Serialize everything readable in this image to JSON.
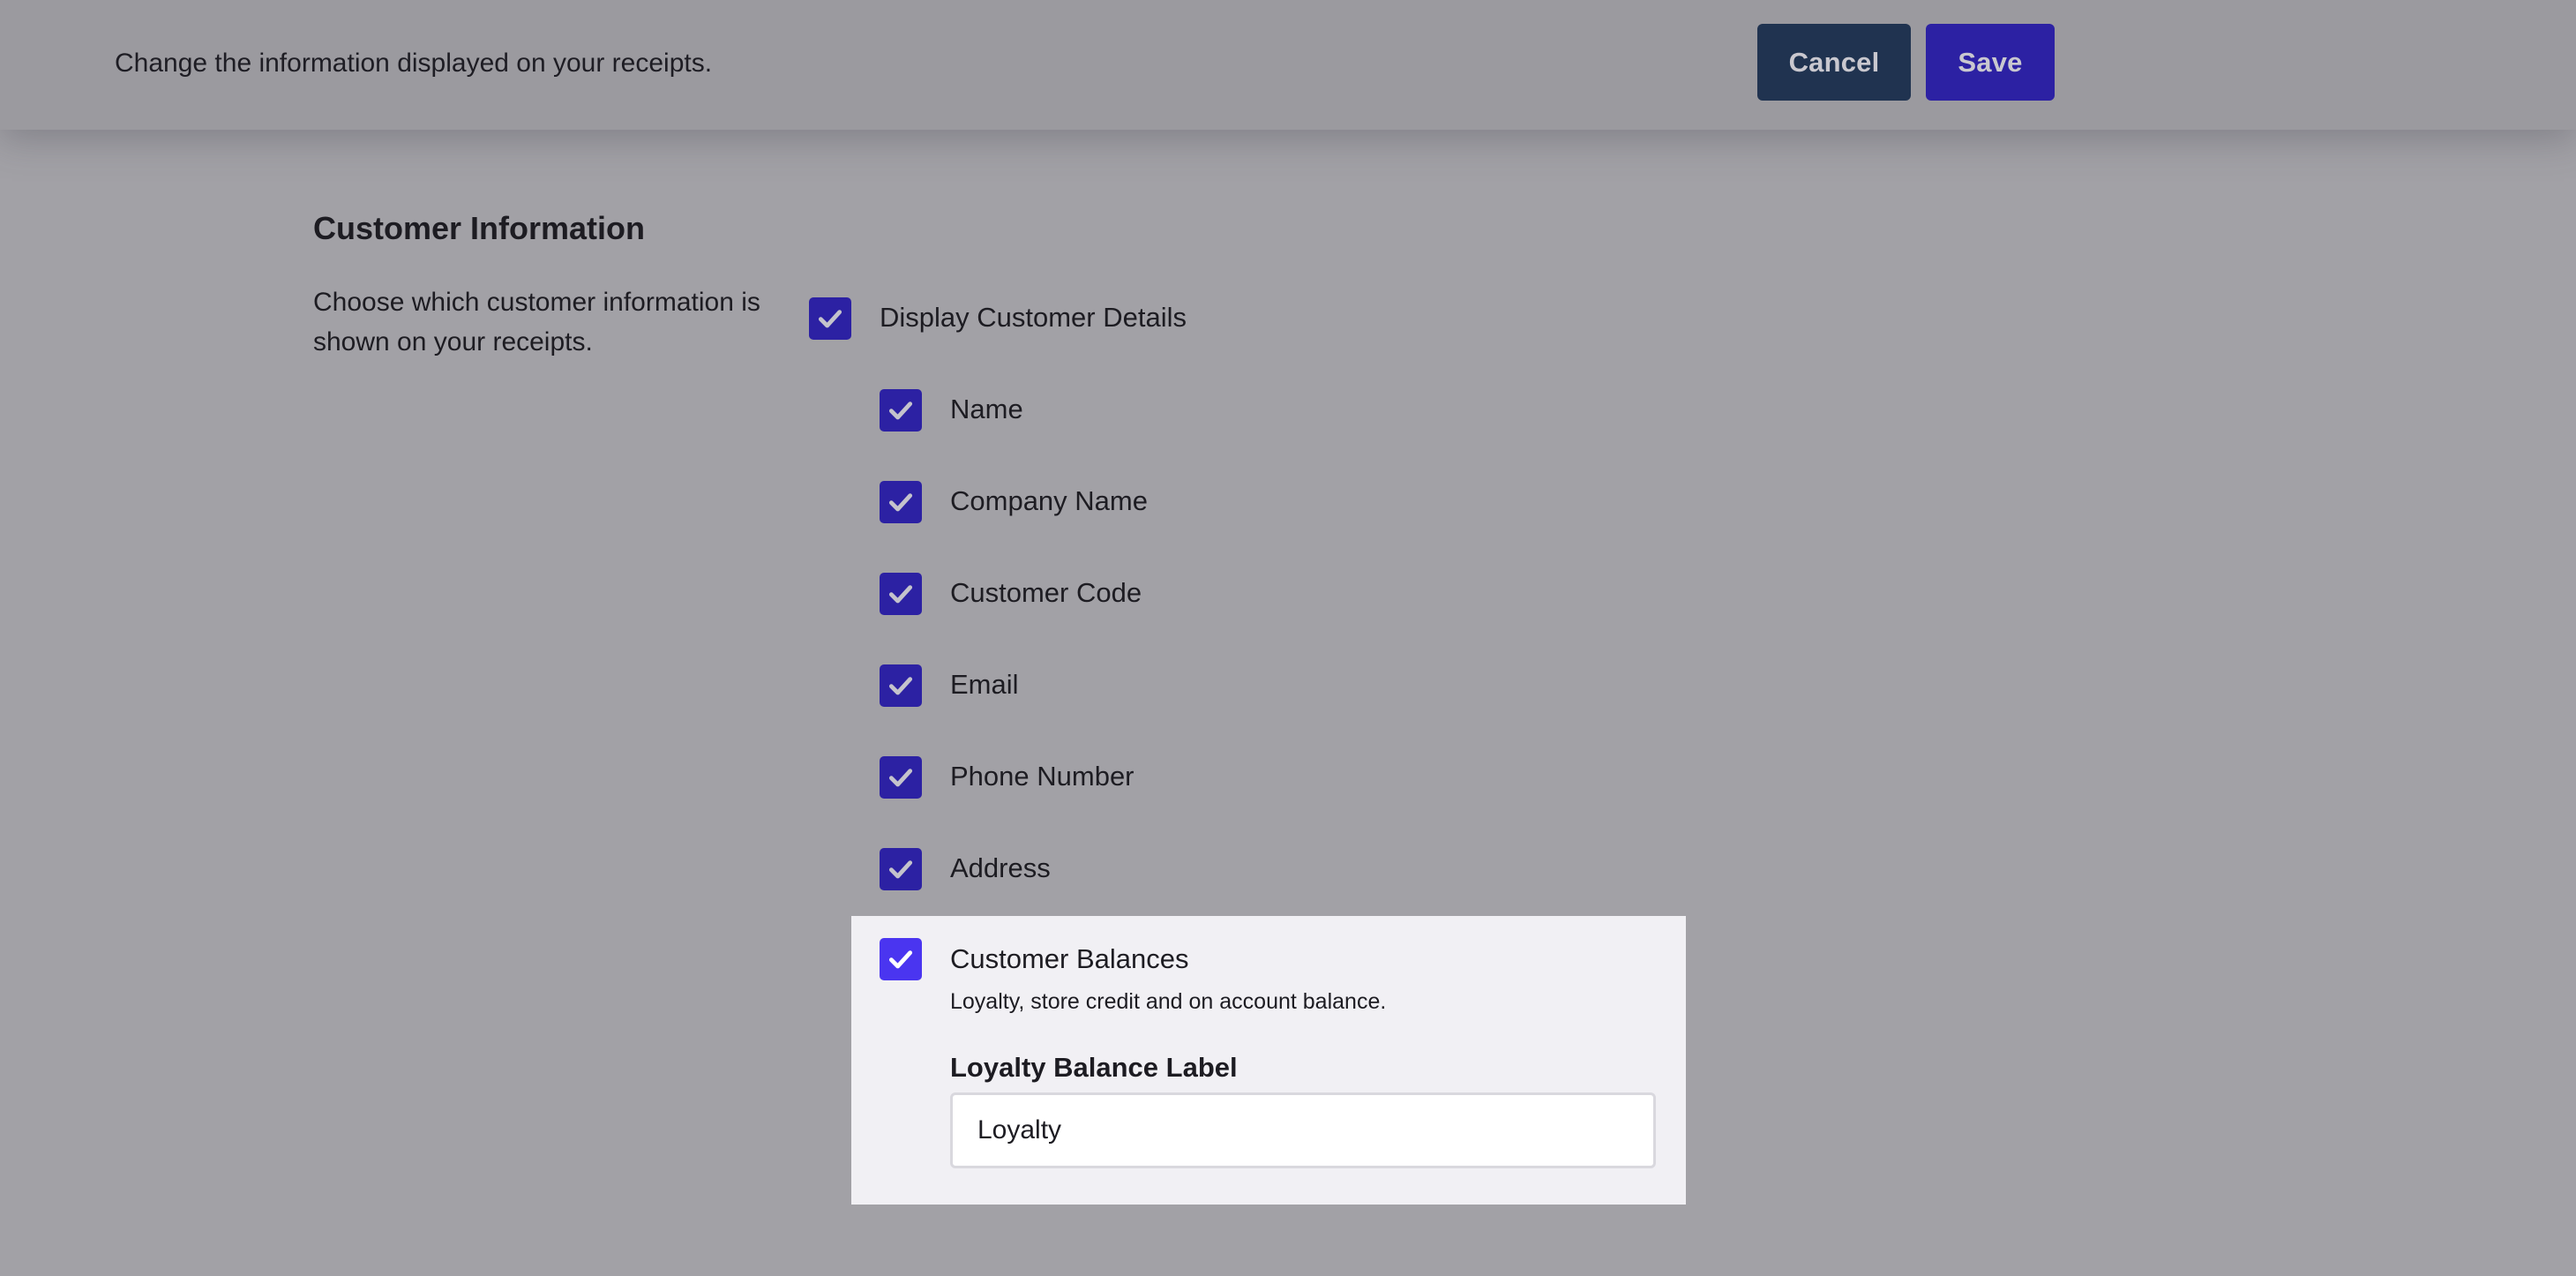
{
  "header": {
    "description": "Change the information displayed on your receipts.",
    "cancel_label": "Cancel",
    "save_label": "Save"
  },
  "section": {
    "title": "Customer Information",
    "description": "Choose which customer information is shown on your receipts."
  },
  "options": {
    "display_customer_details": {
      "label": "Display Customer Details",
      "checked": true
    },
    "name": {
      "label": "Name",
      "checked": true
    },
    "company_name": {
      "label": "Company Name",
      "checked": true
    },
    "customer_code": {
      "label": "Customer Code",
      "checked": true
    },
    "email": {
      "label": "Email",
      "checked": true
    },
    "phone_number": {
      "label": "Phone Number",
      "checked": true
    },
    "address": {
      "label": "Address",
      "checked": true
    },
    "customer_balances": {
      "label": "Customer Balances",
      "checked": true,
      "description": "Loyalty, store credit and on account balance."
    }
  },
  "loyalty_field": {
    "label": "Loyalty Balance Label",
    "value": "Loyalty"
  },
  "colors": {
    "overlay_bg": "#a2a1a6",
    "primary": "#2c21a3",
    "primary_bright": "#4a35f0",
    "cancel_bg": "#203350",
    "panel_bg": "#f1f0f4"
  },
  "icons": {
    "checkbox": "checkmark-icon"
  }
}
